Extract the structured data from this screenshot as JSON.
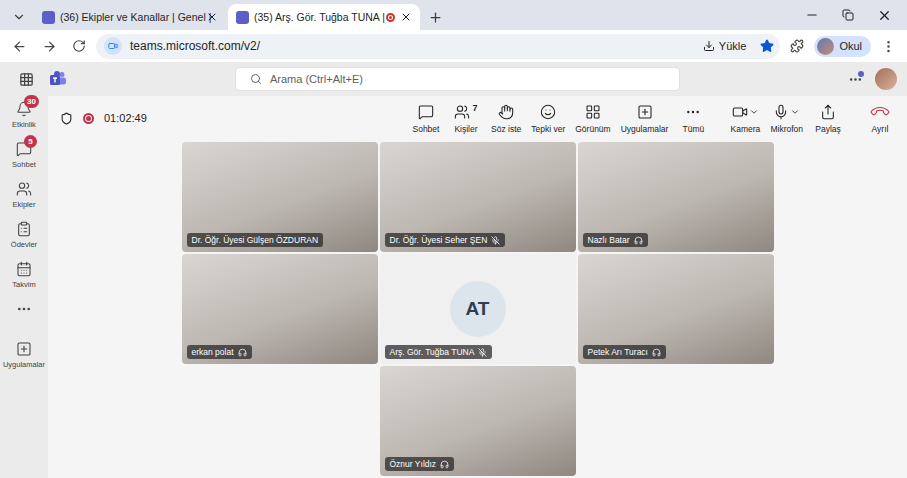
{
  "browser": {
    "tabs": [
      {
        "label": "(36) Ekipler ve Kanallar | Genel |",
        "selected": false,
        "recording": false
      },
      {
        "label": "(35) Arş. Gör. Tuğba TUNA |",
        "selected": true,
        "recording": true
      }
    ],
    "address": "teams.microsoft.com/v2/",
    "install_button": "Yükle",
    "bookmarked": true,
    "profile": "Okul"
  },
  "teams": {
    "search_placeholder": "Arama (Ctrl+Alt+E)",
    "rail": [
      {
        "label": "Etkinlik",
        "kind": "activity",
        "badge": "30"
      },
      {
        "label": "Sohbet",
        "kind": "chat",
        "badge": "5"
      },
      {
        "label": "Ekipler",
        "kind": "teams",
        "badge": ""
      },
      {
        "label": "Ödevler",
        "kind": "assignments",
        "badge": ""
      },
      {
        "label": "Takvim",
        "kind": "calendar",
        "badge": ""
      },
      {
        "label": "Uygulamalar",
        "kind": "apps",
        "badge": ""
      }
    ]
  },
  "meeting": {
    "timer": "01:02:49",
    "recording": true,
    "controls": [
      {
        "label": "Sohbet",
        "kind": "chat",
        "count": "",
        "dropdown": false
      },
      {
        "label": "Kişiler",
        "kind": "people",
        "count": "7",
        "dropdown": false
      },
      {
        "label": "Söz iste",
        "kind": "raise-hand",
        "count": "",
        "dropdown": false
      },
      {
        "label": "Tepki ver",
        "kind": "react",
        "count": "",
        "dropdown": false
      },
      {
        "label": "Görünüm",
        "kind": "view",
        "count": "",
        "dropdown": false
      },
      {
        "label": "Uygulamalar",
        "kind": "apps",
        "count": "",
        "dropdown": false
      },
      {
        "label": "Tümü",
        "kind": "more",
        "count": "",
        "dropdown": false
      },
      {
        "label": "Kamera",
        "kind": "camera",
        "count": "",
        "dropdown": true
      },
      {
        "label": "Mikrofon",
        "kind": "mic",
        "count": "",
        "dropdown": true
      },
      {
        "label": "Paylaş",
        "kind": "share",
        "count": "",
        "dropdown": false
      },
      {
        "label": "Ayrıl",
        "kind": "leave",
        "count": "",
        "dropdown": false
      }
    ],
    "tiles": [
      {
        "name": "Dr. Öğr. Üyesi Gülşen ÖZDURAN",
        "kind": "video",
        "audio_icon": "none",
        "initials": ""
      },
      {
        "name": "Dr. Öğr. Üyesi Seher ŞEN",
        "kind": "video",
        "audio_icon": "mic-off",
        "initials": ""
      },
      {
        "name": "Nazlı Batar",
        "kind": "video",
        "audio_icon": "device",
        "initials": ""
      },
      {
        "name": "erkan polat",
        "kind": "video",
        "audio_icon": "device",
        "initials": ""
      },
      {
        "name": "Arş. Gör. Tuğba TUNA",
        "kind": "avatar",
        "audio_icon": "mic-off",
        "initials": "AT"
      },
      {
        "name": "Petek Arı Turacı",
        "kind": "video",
        "audio_icon": "device",
        "initials": ""
      },
      {
        "name": "Öznur Yıldız",
        "kind": "video",
        "audio_icon": "device",
        "initials": ""
      }
    ]
  }
}
